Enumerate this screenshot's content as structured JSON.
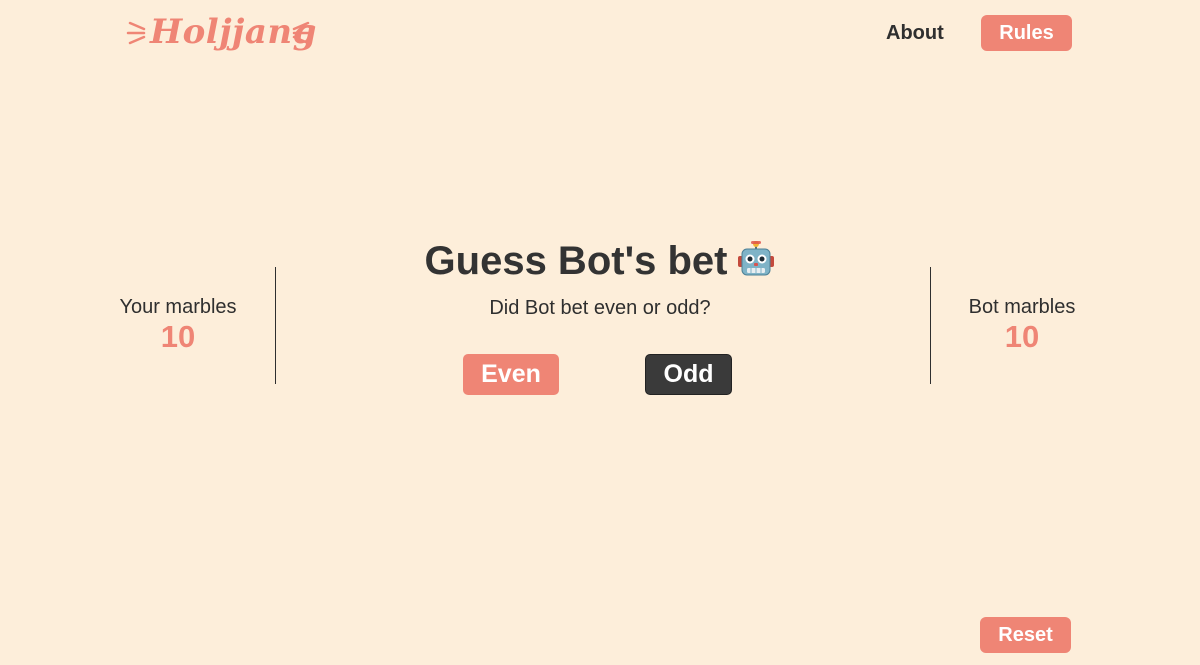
{
  "header": {
    "logo_text": "Holjjang",
    "nav_about": "About",
    "nav_rules": "Rules"
  },
  "player": {
    "label": "Your marbles",
    "marbles": "10"
  },
  "bot": {
    "label": "Bot marbles",
    "marbles": "10"
  },
  "game": {
    "title": "Guess Bot's bet",
    "title_icon": "robot-icon",
    "question": "Did Bot bet even or odd?",
    "even_label": "Even",
    "odd_label": "Odd"
  },
  "footer": {
    "reset_label": "Reset"
  },
  "colors": {
    "background": "#fdeeda",
    "accent": "#ef8575",
    "dark": "#3a3a3a",
    "text": "#2f2f2f"
  }
}
